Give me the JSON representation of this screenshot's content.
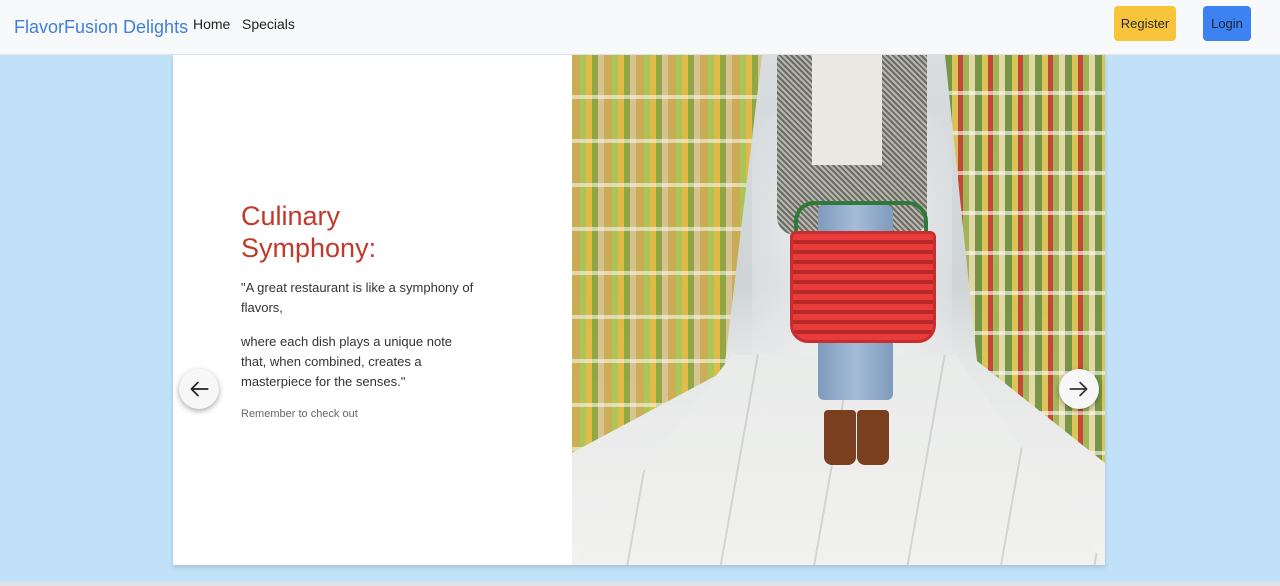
{
  "navbar": {
    "brand": "FlavorFusion Delights",
    "links": [
      "Home",
      "Specials"
    ],
    "register_label": "Register",
    "login_label": "Login"
  },
  "carousel": {
    "title": "Culinary Symphony:",
    "quote_line_1": "\"A great restaurant is like a symphony of flavors,",
    "quote_line_2": "where each dish plays a unique note that, when combined, creates a masterpiece for the senses.\"",
    "footnote": "Remember to check out",
    "prev_icon": "arrow-left-icon",
    "next_icon": "arrow-right-icon"
  },
  "colors": {
    "background": "#c1e1f8",
    "brand": "#3f7fd9",
    "title": "#c0392b",
    "register": "#f8c43a",
    "login": "#3d82f2"
  }
}
